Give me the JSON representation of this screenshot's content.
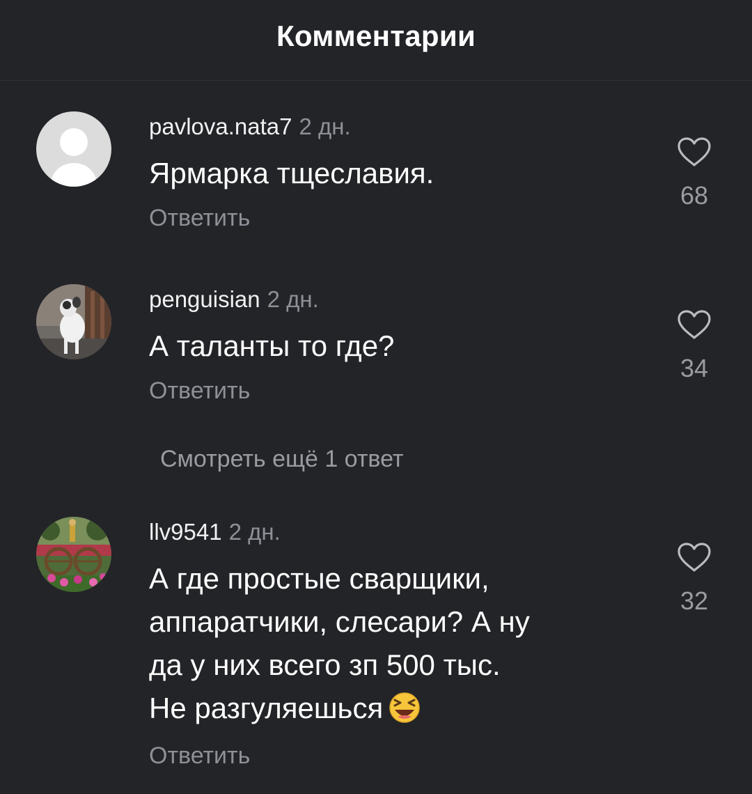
{
  "header": {
    "title": "Комментарии"
  },
  "comments": [
    {
      "username": "pavlova.nata7",
      "time": "2 дн.",
      "text": "Ярмарка  тщеславия.",
      "reply_label": "Ответить",
      "likes": "68"
    },
    {
      "username": "penguisian",
      "time": "2 дн.",
      "text": "А таланты то где?",
      "reply_label": "Ответить",
      "likes": "34"
    },
    {
      "username": "llv9541",
      "time": "2 дн.",
      "text_lines": [
        "А где простые сварщики,",
        "аппаратчики, слесари?  А ну",
        "да у них всего зп 500 тыс.",
        "Не разгуляешься"
      ],
      "emoji": "laughing-emoji",
      "reply_label": "Ответить",
      "likes": "32"
    }
  ],
  "more_replies_label": "Смотреть ещё 1 ответ",
  "colors": {
    "background": "#232428",
    "secondary_text": "#8e9097",
    "primary_text": "#ffffff"
  }
}
